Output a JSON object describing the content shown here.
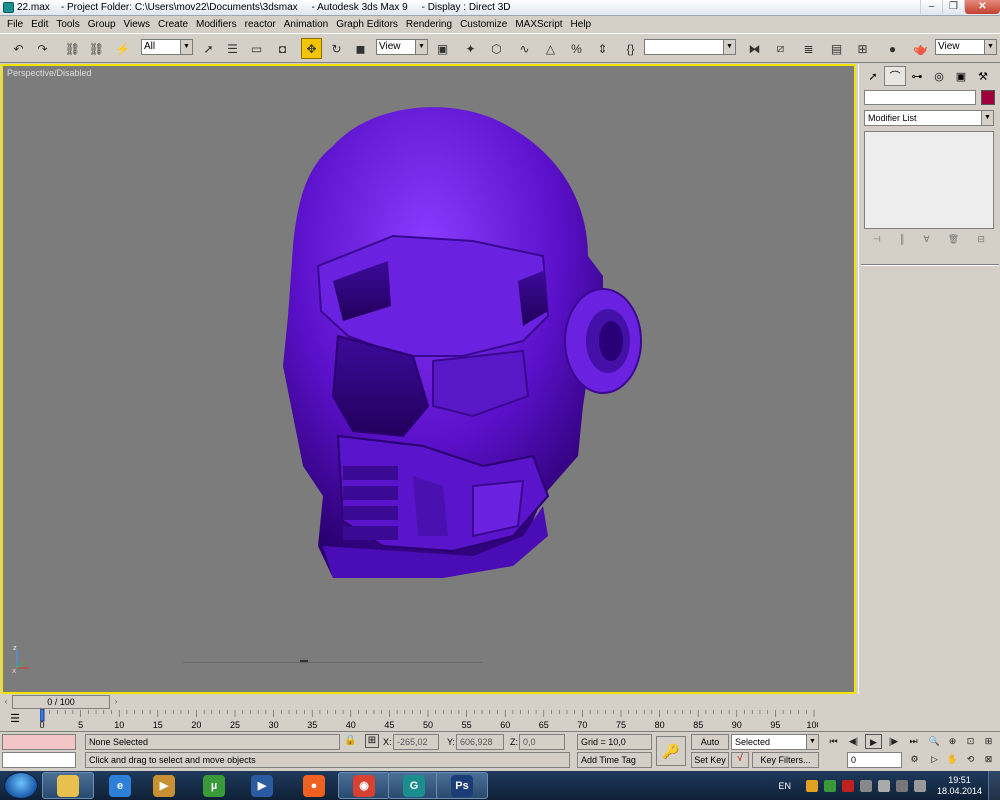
{
  "window": {
    "title": "22.max    - Project Folder: C:\\Users\\mov22\\Documents\\3dsmax     - Autodesk 3ds Max 9     - Display : Direct 3D",
    "buttons": [
      "–",
      "❐",
      "✕"
    ]
  },
  "menu": [
    "File",
    "Edit",
    "Tools",
    "Group",
    "Views",
    "Create",
    "Modifiers",
    "reactor",
    "Animation",
    "Graph Editors",
    "Rendering",
    "Customize",
    "MAXScript",
    "Help"
  ],
  "toolbar": {
    "selection_filter": "All",
    "ref_coord": "View",
    "named_sel": "",
    "view_right": "View"
  },
  "viewport": {
    "label": "Perspective/Disabled",
    "object_color": "#5a10c8",
    "axis_z": "z",
    "axis_x": "x"
  },
  "command_panel": {
    "object_color": "#a0003a",
    "modifier_list": "Modifier List"
  },
  "time_slider": {
    "position": "0 / 100",
    "ticks": [
      "0",
      "5",
      "10",
      "15",
      "20",
      "25",
      "30",
      "35",
      "40",
      "45",
      "50",
      "55",
      "60",
      "65",
      "70",
      "75",
      "80",
      "85",
      "90",
      "95",
      "100"
    ]
  },
  "status": {
    "selection": "None Selected",
    "prompt": "Click and drag to select and move objects",
    "x_label": "X:",
    "x_value": "-265,02",
    "y_label": "Y:",
    "y_value": "606,928",
    "z_label": "Z:",
    "z_value": "0,0",
    "grid": "Grid = 10,0",
    "add_time_tag": "Add Time Tag",
    "auto_key": "Auto Key",
    "set_key": "Set Key",
    "key_mode": "Selected",
    "key_filters": "Key Filters...",
    "frame": "0"
  },
  "taskbar": {
    "lang": "EN",
    "time": "19:51",
    "date": "18.04.2014",
    "apps": [
      {
        "name": "explorer",
        "color": "#e8c050",
        "glyph": ""
      },
      {
        "name": "ie",
        "color": "#2d7fd8",
        "glyph": "e"
      },
      {
        "name": "media",
        "color": "#c89030",
        "glyph": "▶"
      },
      {
        "name": "utorrent",
        "color": "#3a9a3a",
        "glyph": "µ"
      },
      {
        "name": "player",
        "color": "#2a5aa0",
        "glyph": "▶"
      },
      {
        "name": "origin",
        "color": "#f06020",
        "glyph": "●"
      },
      {
        "name": "chrome",
        "color": "#d84030",
        "glyph": "◉"
      },
      {
        "name": "3dsmax",
        "color": "#1b8f8f",
        "glyph": "G"
      },
      {
        "name": "photoshop",
        "color": "#1c3c78",
        "glyph": "Ps"
      }
    ]
  }
}
